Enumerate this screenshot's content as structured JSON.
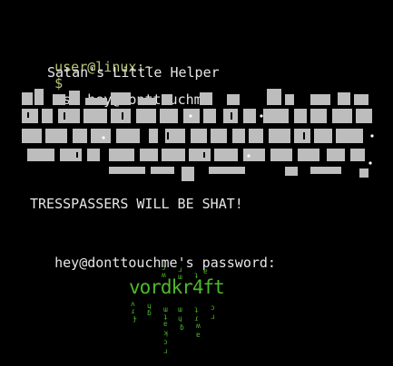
{
  "terminal": {
    "user_host": "user@linux:~",
    "prompt_symbol": "$",
    "command": "ssh hey@donttouchme",
    "banner_title": "Satan's Little Helper",
    "warning": "TRESSPASSERS WILL BE SHAT!",
    "password_prompt": "hey@donttouchme's password:"
  },
  "logo": {
    "text": "vordkr4ft",
    "color": "#4fb82a"
  },
  "colors": {
    "background": "#000000",
    "foreground": "#e6e6e6",
    "prompt": "#b7c57a",
    "banner_blocks": "#bdbdbd"
  }
}
